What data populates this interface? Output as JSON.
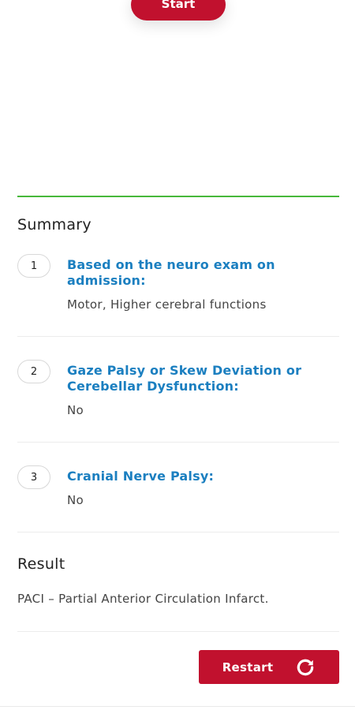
{
  "start_button": {
    "label": "Start"
  },
  "summary": {
    "title": "Summary",
    "items": [
      {
        "number": "1",
        "question": "Based on the neuro exam on admission:",
        "answer": "Motor, Higher cerebral functions"
      },
      {
        "number": "2",
        "question": "Gaze Palsy or Skew Deviation or Cerebellar Dysfunction:",
        "answer": "No"
      },
      {
        "number": "3",
        "question": "Cranial Nerve Palsy:",
        "answer": "No"
      }
    ]
  },
  "result": {
    "title": "Result",
    "text": "PACI – Partial Anterior Circulation Infarct."
  },
  "restart_button": {
    "label": "Restart",
    "icon": "refresh-icon"
  },
  "colors": {
    "accent_red": "#c1112e",
    "link_blue": "#1b7fc0",
    "divider_green": "#47b83a"
  }
}
